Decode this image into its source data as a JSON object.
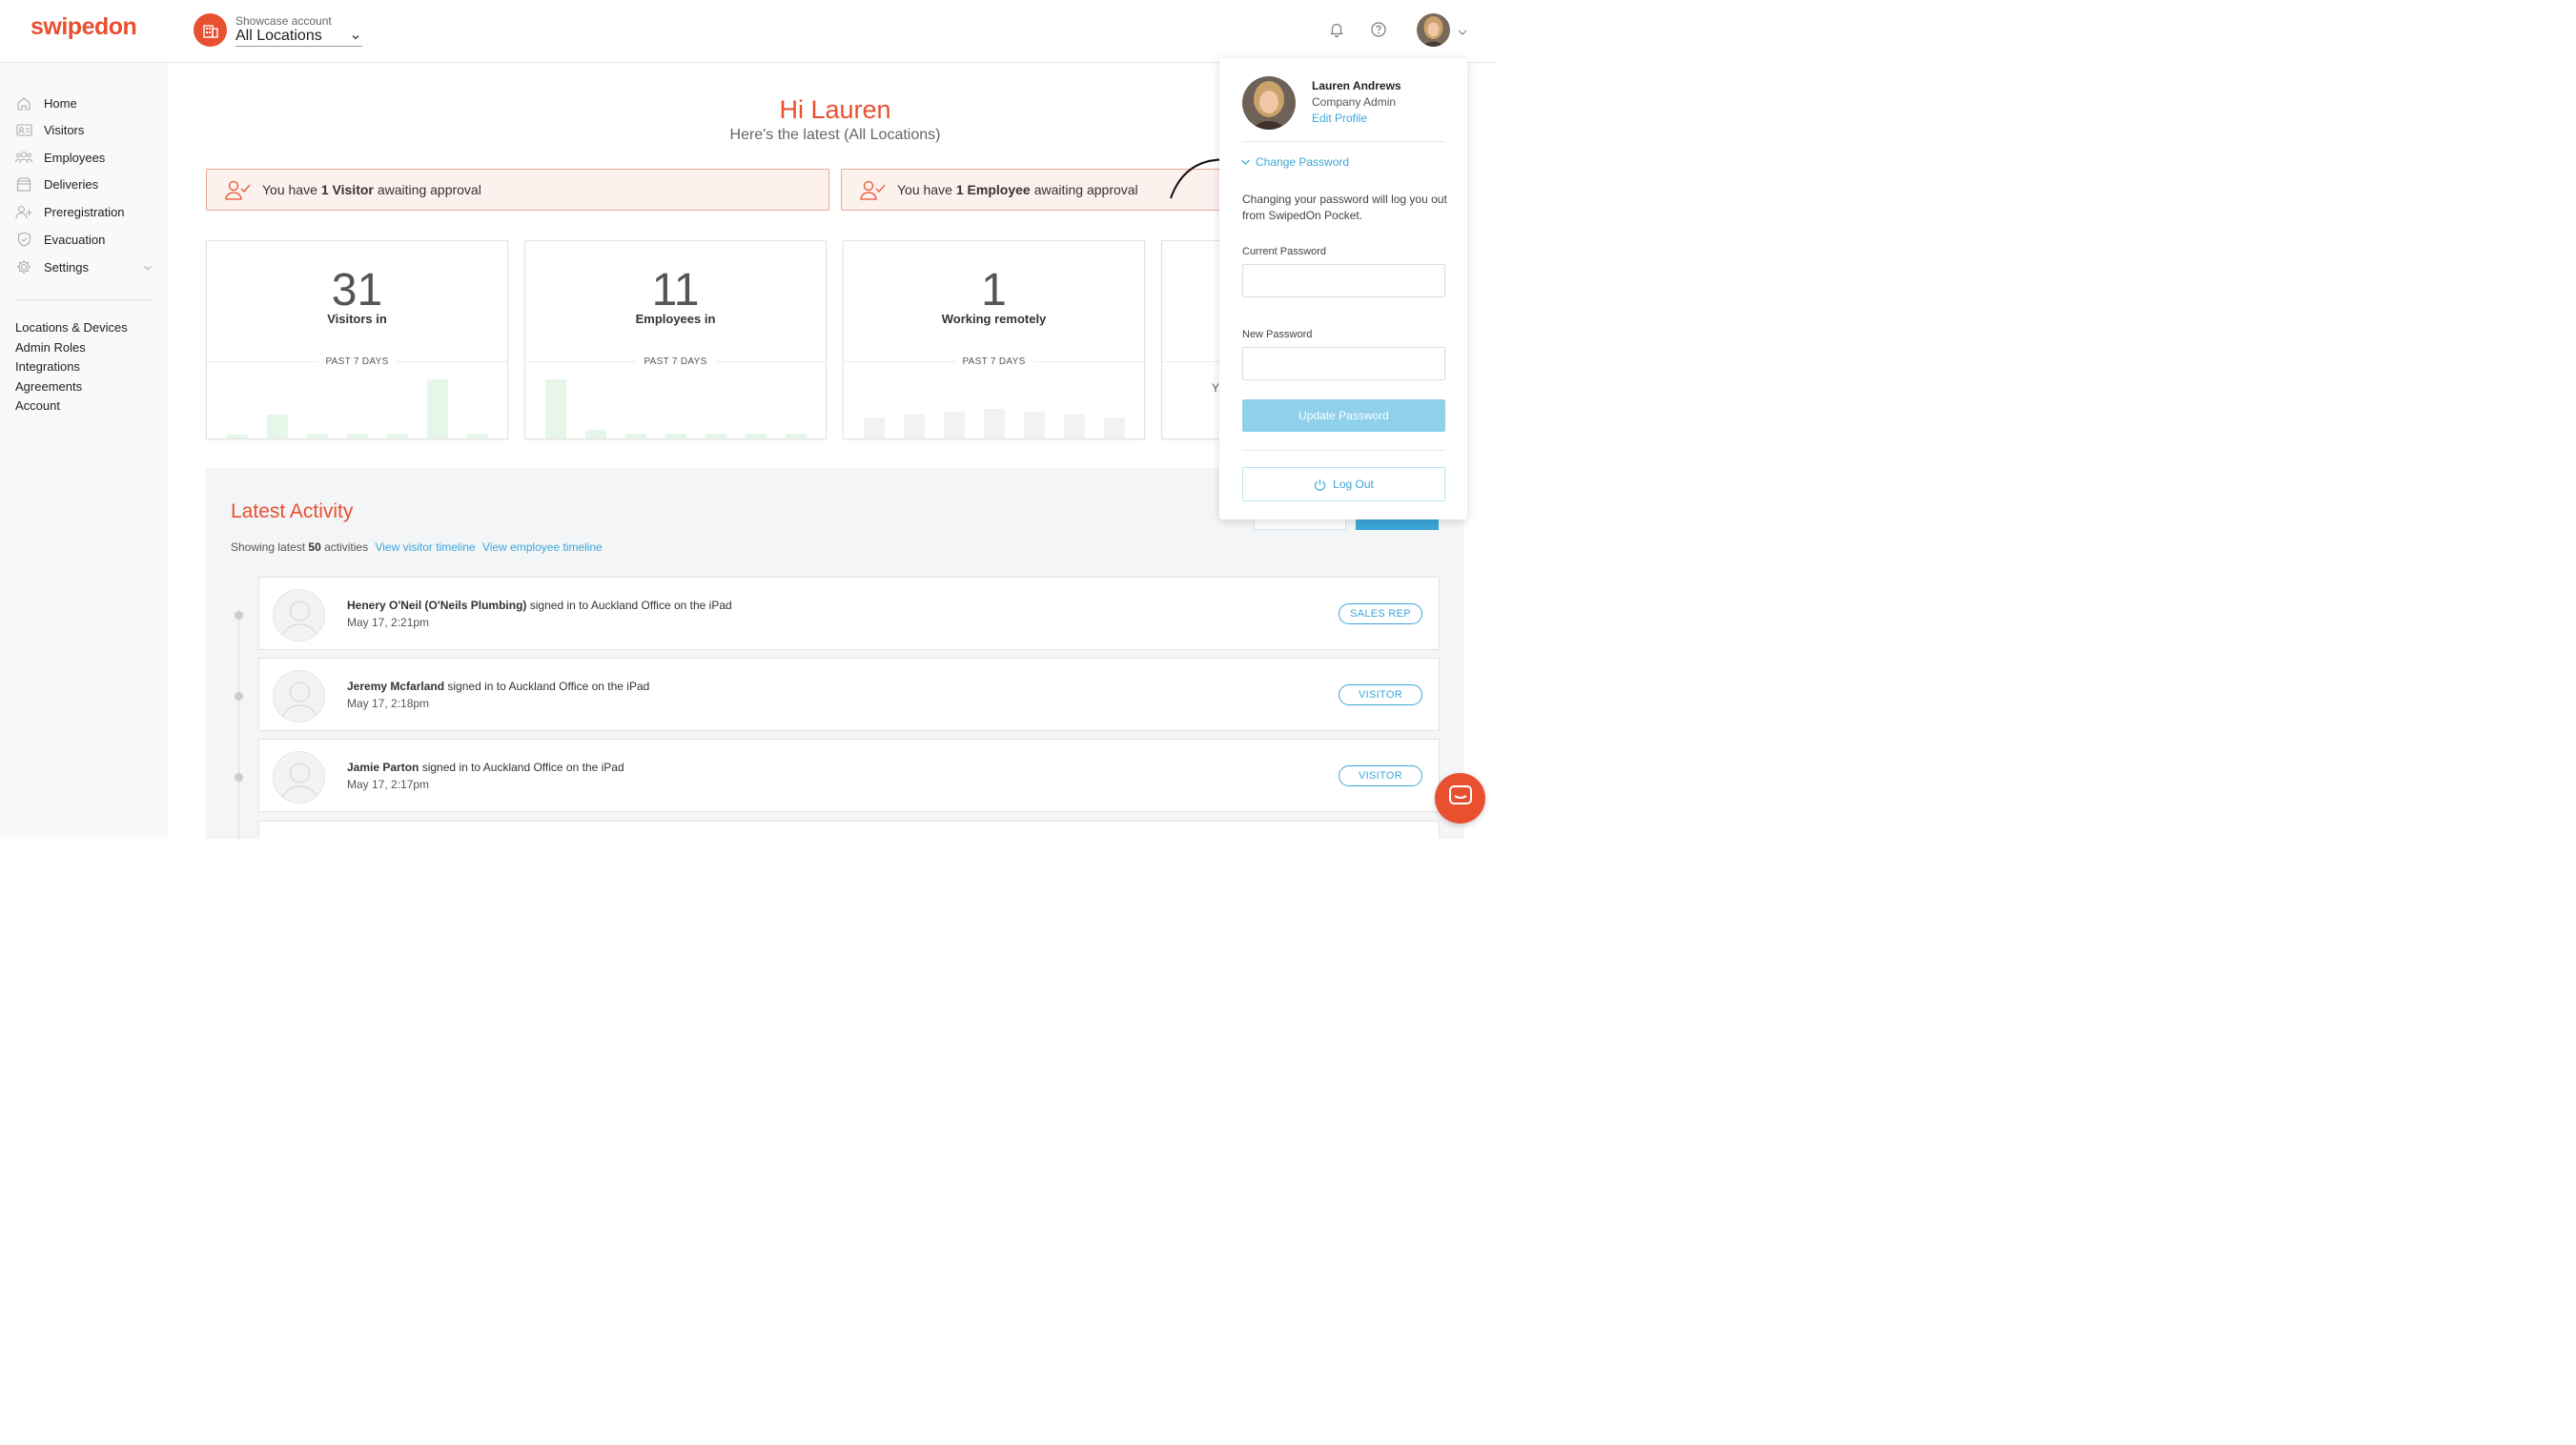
{
  "brand": {
    "logo_text": "swipedon",
    "accent": "#e8502f",
    "link": "#3aa7d8"
  },
  "header": {
    "account_caption": "Showcase account",
    "location_select": "All Locations"
  },
  "sidebar": {
    "items": [
      {
        "label": "Home",
        "icon": "home-icon"
      },
      {
        "label": "Visitors",
        "icon": "visitor-card-icon"
      },
      {
        "label": "Employees",
        "icon": "employees-icon"
      },
      {
        "label": "Deliveries",
        "icon": "delivery-box-icon"
      },
      {
        "label": "Preregistration",
        "icon": "add-user-icon"
      },
      {
        "label": "Evacuation",
        "icon": "shield-icon"
      },
      {
        "label": "Settings",
        "icon": "gear-icon"
      }
    ],
    "links": [
      "Locations & Devices",
      "Admin Roles",
      "Integrations",
      "Agreements",
      "Account"
    ]
  },
  "greeting": {
    "title": "Hi Lauren",
    "subtitle": "Here's the latest (All Locations)"
  },
  "alerts": [
    {
      "prefix": "You have",
      "count_label": "1 Visitor",
      "suffix": "awaiting approval"
    },
    {
      "prefix": "You have",
      "count_label": "1 Employee",
      "suffix": "awaiting approval"
    }
  ],
  "stats": [
    {
      "value": "31",
      "label": "Visitors in",
      "period": "PAST 7 DAYS",
      "bar_color": "#e6f7ea",
      "bars": [
        0.05,
        0.4,
        0.08,
        0.08,
        0.08,
        1.0,
        0.08
      ]
    },
    {
      "value": "11",
      "label": "Employees in",
      "period": "PAST 7 DAYS",
      "bar_color": "#e6f7ea",
      "bars": [
        1.0,
        0.15,
        0.08,
        0.08,
        0.08,
        0.08,
        0.08
      ]
    },
    {
      "value": "1",
      "label": "Working remotely",
      "period": "PAST 7 DAYS",
      "bar_color": "#f1f2f3",
      "bars": [
        0.35,
        0.4,
        0.45,
        0.5,
        0.45,
        0.4,
        0.35
      ]
    },
    {
      "partial_text": "Y"
    }
  ],
  "activity": {
    "title": "Latest Activity",
    "showing_prefix": "Showing latest",
    "showing_count": "50",
    "showing_suffix": "activities",
    "link_visitor": "View visitor timeline",
    "link_employee": "View employee timeline",
    "rows": [
      {
        "name": "Henery O'Neil (O'Neils Plumbing)",
        "action": "signed in to Auckland Office on the iPad",
        "time": "May 17, 2:21pm",
        "tag": "SALES REP"
      },
      {
        "name": "Jeremy Mcfarland",
        "action": "signed in to Auckland Office on the iPad",
        "time": "May 17, 2:18pm",
        "tag": "VISITOR"
      },
      {
        "name": "Jamie Parton",
        "action": "signed in to Auckland Office on the iPad",
        "time": "May 17, 2:17pm",
        "tag": "VISITOR"
      }
    ]
  },
  "profile": {
    "name": "Lauren Andrews",
    "role": "Company Admin",
    "edit_link": "Edit Profile",
    "change_password": "Change Password",
    "note": "Changing your password will log you out from SwipedOn Pocket.",
    "current_password_label": "Current Password",
    "current_password_value": "",
    "new_password_label": "New Password",
    "new_password_value": "",
    "update_button": "Update Password",
    "logout_button": "Log Out"
  }
}
